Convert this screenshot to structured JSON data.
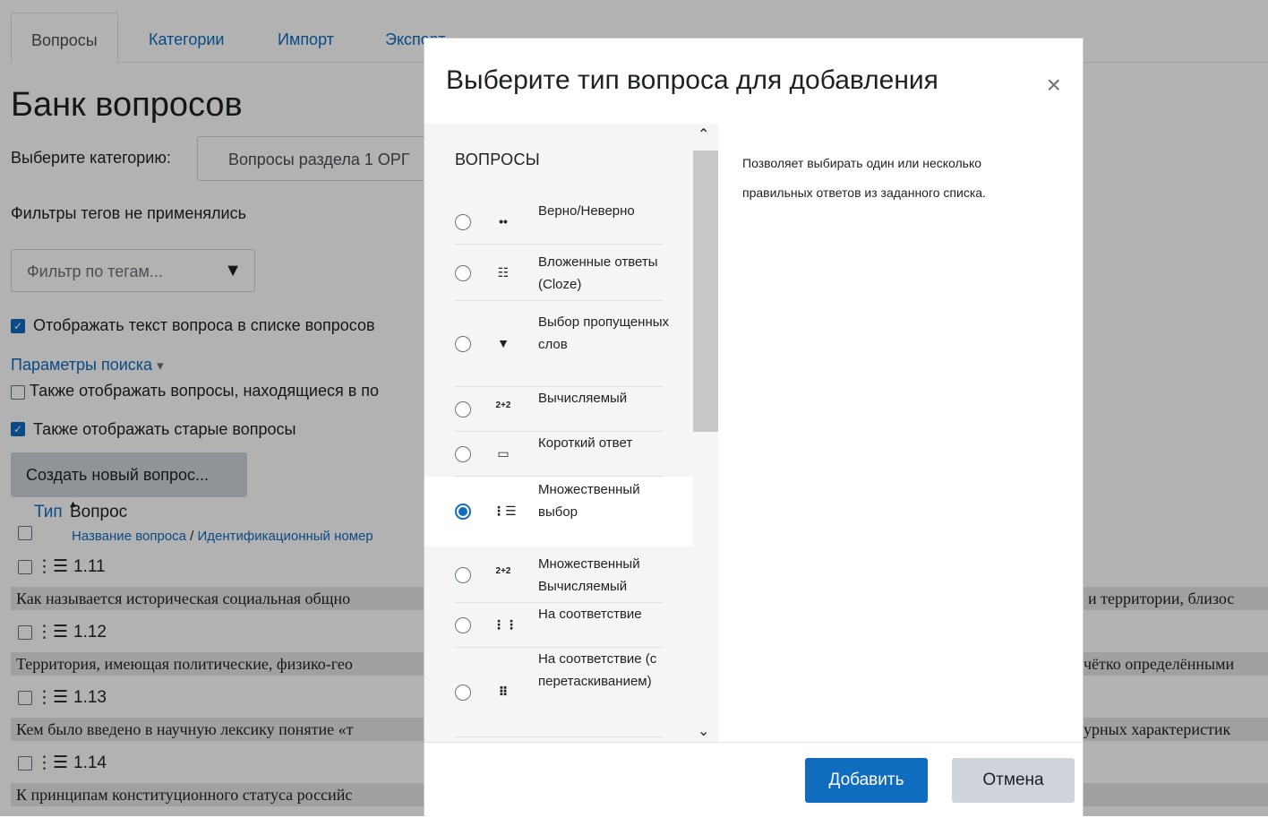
{
  "tabs": [
    "Вопросы",
    "Категории",
    "Импорт",
    "Экспорт"
  ],
  "page": {
    "title": "Банк вопросов",
    "category_label": "Выберите категорию:",
    "category_value": "Вопросы раздела 1 ОРГ",
    "tags_none": "Фильтры тегов не применялись",
    "tag_filter_placeholder": "Фильтр по тегам...",
    "tag_filter_arrow": "▼",
    "show_text": "Отображать текст вопроса в списке вопросов",
    "search_params": "Параметры поиска",
    "search_params_caret": "▾",
    "also_sub": "Также отображать вопросы, находящиеся в по",
    "also_old": "Также отображать старые вопросы",
    "create_button": "Создать новый вопрос...",
    "col_type": "Тип",
    "col_question": "Вопрос",
    "sort_arrow": "▲",
    "col_sub_name": "Название вопроса",
    "col_sub_sep": " / ",
    "col_sub_id": "Идентификационный номер",
    "check_mark": "✓",
    "rows": [
      {
        "name": "1.11",
        "text": "Как называется историческая социальная общно",
        "text_right": "и территории, близос"
      },
      {
        "name": "1.12",
        "text": "Территория, имеющая политические, физико-гео",
        "text_right": "чётко определёнными"
      },
      {
        "name": "1.13",
        "text": "Кем было введено в научную лексику понятие «т",
        "text_right": "урных характеристик"
      },
      {
        "name": "1.14",
        "text": "К принципам конституционного статуса российс",
        "text_right": ""
      }
    ],
    "row_icon": "⋮☰"
  },
  "modal": {
    "title": "Выберите тип вопроса для добавления",
    "close": "×",
    "section": "ВОПРОСЫ",
    "options": [
      {
        "label": "Верно/Неверно",
        "icon": "••",
        "icon_name": "true-false-icon"
      },
      {
        "label": "Вложенные ответы (Cloze)",
        "icon": "☷",
        "icon_name": "cloze-icon"
      },
      {
        "label": "Выбор пропущенных слов",
        "icon": "▼",
        "icon_name": "select-missing-words-icon"
      },
      {
        "label": "Вычисляемый",
        "icon": "2+2",
        "icon_name": "calculated-icon"
      },
      {
        "label": "Короткий ответ",
        "icon": "▭",
        "icon_name": "short-answer-icon"
      },
      {
        "label": "Множественный выбор",
        "icon": "⋮☰",
        "icon_name": "multichoice-icon",
        "selected": true
      },
      {
        "label": "Множественный Вычисляемый",
        "icon": "2+2",
        "icon_name": "calculated-multi-icon"
      },
      {
        "label": "На соответствие",
        "icon": "⋮⋮",
        "icon_name": "matching-icon"
      },
      {
        "label": "На соответствие (с перетаскиванием)",
        "icon": "⠿",
        "icon_name": "drag-matching-icon"
      }
    ],
    "scroll_up": "⌃",
    "scroll_down": "⌄",
    "description": "Позволяет выбирать один или несколько правильных ответов из заданного списка.",
    "add_button": "Добавить",
    "cancel_button": "Отмена"
  },
  "colors": {
    "accent": "#0f6cbf",
    "secondary": "#ced4da"
  }
}
